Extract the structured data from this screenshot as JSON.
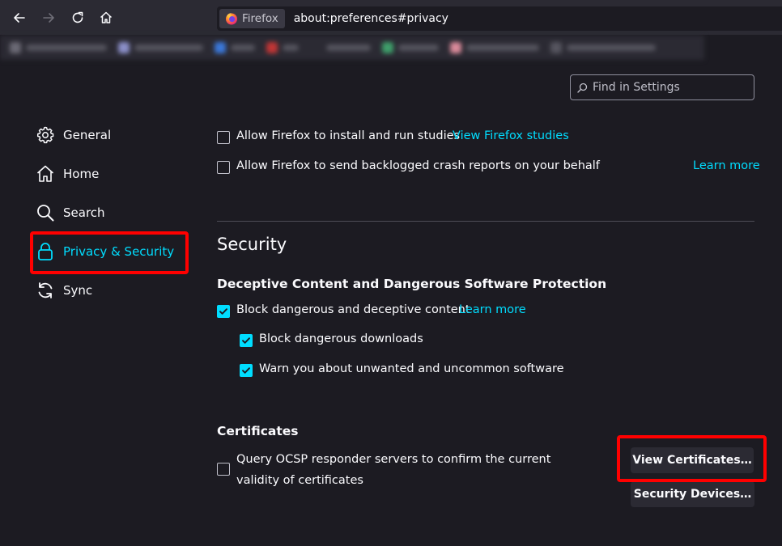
{
  "browser": {
    "identity_label": "Firefox",
    "url": "about:preferences#privacy"
  },
  "search": {
    "placeholder": "Find in Settings"
  },
  "sidebar": {
    "items": [
      {
        "label": "General",
        "icon": "gear-icon"
      },
      {
        "label": "Home",
        "icon": "home-icon"
      },
      {
        "label": "Search",
        "icon": "magnifier-icon"
      },
      {
        "label": "Privacy & Security",
        "icon": "lock-icon",
        "selected": true
      },
      {
        "label": "Sync",
        "icon": "sync-icon"
      }
    ]
  },
  "data_collection": {
    "studies_label": "Allow Firefox to install and run studies",
    "studies_checked": false,
    "studies_link": "View Firefox studies",
    "crash_label": "Allow Firefox to send backlogged crash reports on your behalf",
    "crash_checked": false,
    "crash_link": "Learn more"
  },
  "security": {
    "heading": "Security",
    "deceptive_heading": "Deceptive Content and Dangerous Software Protection",
    "block_deceptive_label": "Block dangerous and deceptive content",
    "block_deceptive_checked": true,
    "block_deceptive_link": "Learn more",
    "block_downloads_label": "Block dangerous downloads",
    "block_downloads_checked": true,
    "warn_unwanted_label": "Warn you about unwanted and uncommon software",
    "warn_unwanted_checked": true
  },
  "certificates": {
    "heading": "Certificates",
    "ocsp_label": "Query OCSP responder servers to confirm the current validity of certificates",
    "ocsp_checked": false,
    "view_button": "View Certificates…",
    "devices_button": "Security Devices…"
  },
  "colors": {
    "accent": "#00ddff",
    "highlight": "#ff0000",
    "background": "#1c1b22"
  }
}
